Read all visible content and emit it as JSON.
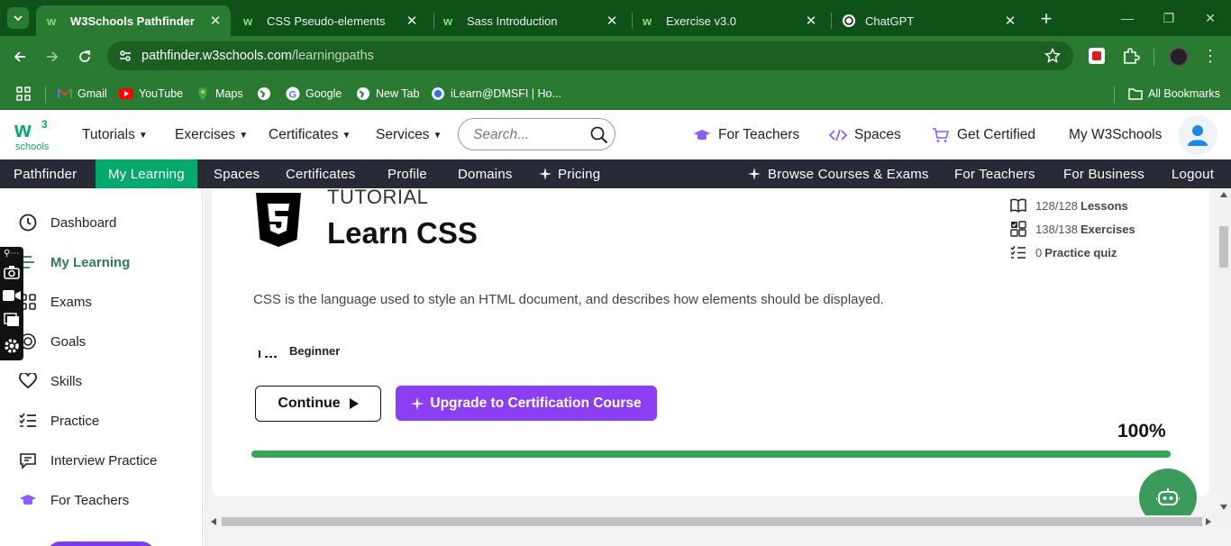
{
  "browser": {
    "tabs": [
      {
        "title": "W3Schools Pathfinder",
        "active": true,
        "icon": "w3schools-icon"
      },
      {
        "title": "CSS Pseudo-elements",
        "active": false,
        "icon": "w3schools-icon"
      },
      {
        "title": "Sass Introduction",
        "active": false,
        "icon": "w3schools-icon"
      },
      {
        "title": "Exercise v3.0",
        "active": false,
        "icon": "w3schools-icon"
      },
      {
        "title": "ChatGPT",
        "active": false,
        "icon": "chatgpt-icon"
      }
    ],
    "new_tab_symbol": "+",
    "url_host": "pathfinder.w3schools.com",
    "url_path": "/learningpaths",
    "bookmarks": [
      {
        "label": "Gmail",
        "icon": "gmail-icon"
      },
      {
        "label": "YouTube",
        "icon": "youtube-icon"
      },
      {
        "label": "Maps",
        "icon": "maps-icon"
      },
      {
        "label": "",
        "icon": "globe-icon"
      },
      {
        "label": "Google",
        "icon": "google-icon"
      },
      {
        "label": "New Tab",
        "icon": "globe-icon"
      },
      {
        "label": "iLearn@DMSFI | Ho...",
        "icon": "ilearn-icon"
      }
    ],
    "all_bookmarks": "All Bookmarks",
    "colors": {
      "frame": "#0e5219",
      "toolbar": "#2a7a31"
    }
  },
  "w3header": {
    "logo_text": "schools",
    "logo_sup": "3",
    "nav": [
      {
        "label": "Tutorials"
      },
      {
        "label": "Exercises"
      },
      {
        "label": "Certificates"
      },
      {
        "label": "Services"
      }
    ],
    "search_placeholder": "Search...",
    "right_nav": [
      {
        "label": "For Teachers",
        "icon": "graduation-cap-icon"
      },
      {
        "label": "Spaces",
        "icon": "code-icon"
      },
      {
        "label": "Get Certified",
        "icon": "cart-icon"
      },
      {
        "label": "My W3Schools",
        "icon": ""
      }
    ]
  },
  "darknav": {
    "left": [
      "Pathfinder",
      "My Learning",
      "Spaces",
      "Certificates",
      "Profile",
      "Domains",
      "Pricing"
    ],
    "active": "My Learning",
    "right": [
      "Browse Courses & Exams",
      "For Teachers",
      "For Business",
      "Logout"
    ]
  },
  "sidebar": {
    "items": [
      {
        "label": "Dashboard",
        "icon": "clock-icon"
      },
      {
        "label": "My Learning",
        "icon": "path-icon",
        "active": true
      },
      {
        "label": "Exams",
        "icon": "grid-icon"
      },
      {
        "label": "Goals",
        "icon": "target-icon"
      },
      {
        "label": "Skills",
        "icon": "heart-icon"
      },
      {
        "label": "Practice",
        "icon": "list-check-icon"
      },
      {
        "label": "Interview Practice",
        "icon": "chat-icon"
      },
      {
        "label": "For Teachers",
        "icon": "graduation-cap-icon"
      }
    ]
  },
  "course": {
    "kind": "TUTORIAL",
    "title": "Learn CSS",
    "description": "CSS is the language used to style an HTML document, and describes how elements should be displayed.",
    "stats": [
      {
        "value": "128/128",
        "label": "Lessons",
        "icon": "book-icon"
      },
      {
        "value": "138/138",
        "label": "Exercises",
        "icon": "exercise-grid-icon"
      },
      {
        "value": "0",
        "label": "Practice quiz",
        "icon": "checklist-icon"
      }
    ],
    "level": "Beginner",
    "continue_label": "Continue",
    "upgrade_label": "Upgrade to Certification Course",
    "progress_text": "100%",
    "progress": 1.0,
    "colors": {
      "accent": "#8b3ff0",
      "progress": "#3aa35a",
      "active_nav": "#04aa6d"
    }
  }
}
